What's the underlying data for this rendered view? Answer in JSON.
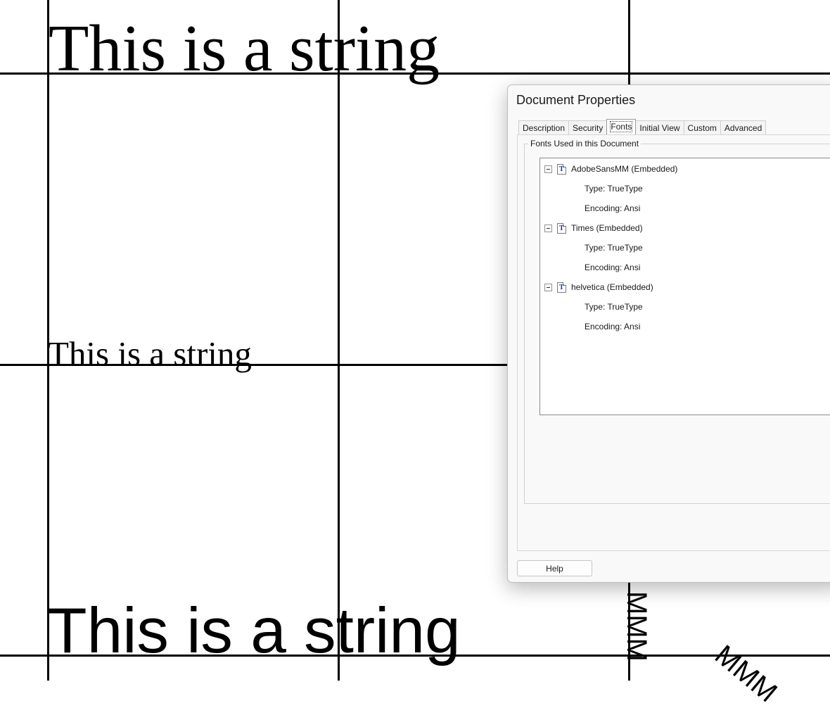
{
  "document": {
    "string_serif_large": "This is a string",
    "string_serif_small": "This is a string",
    "string_sans_large": "This is a string",
    "rotated_vertical": "MMM",
    "rotated_diagonal": "MMM"
  },
  "dialog": {
    "title": "Document Properties",
    "tabs": [
      {
        "label": "Description"
      },
      {
        "label": "Security"
      },
      {
        "label": "Fonts",
        "active": true
      },
      {
        "label": "Initial View"
      },
      {
        "label": "Custom"
      },
      {
        "label": "Advanced"
      }
    ],
    "group_label": "Fonts Used in this Document",
    "font_icon_glyph": "T",
    "fonts": [
      {
        "name": "AdobeSansMM (Embedded)",
        "type": "Type: TrueType",
        "encoding": "Encoding: Ansi"
      },
      {
        "name": "Times (Embedded)",
        "type": "Type: TrueType",
        "encoding": "Encoding: Ansi"
      },
      {
        "name": "helvetica (Embedded)",
        "type": "Type: TrueType",
        "encoding": "Encoding: Ansi"
      }
    ],
    "help_label": "Help"
  }
}
